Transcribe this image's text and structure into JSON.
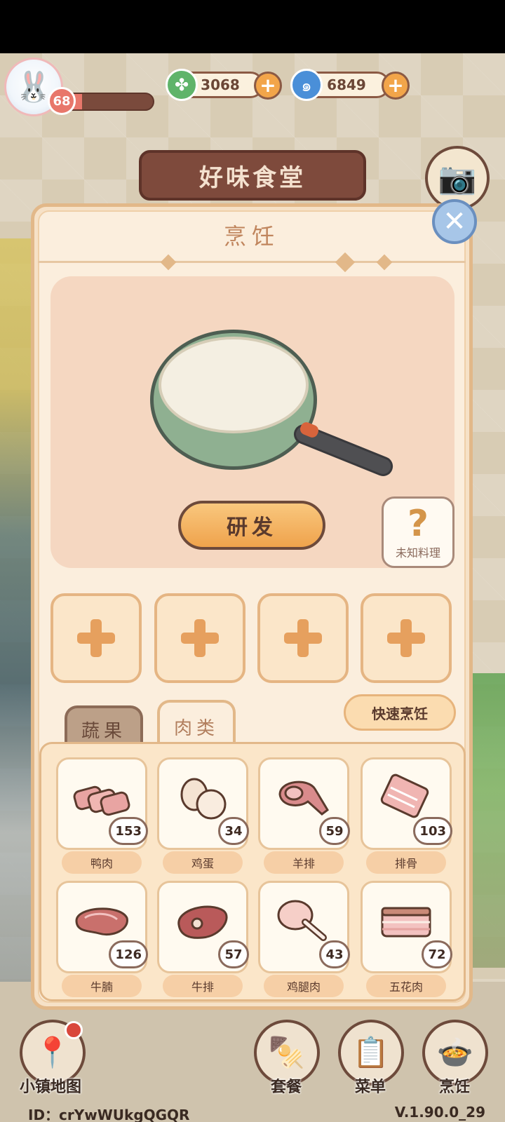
{
  "hud": {
    "level": "68",
    "level_progress": 0.3,
    "currency_green": "3068",
    "currency_blue": "6849"
  },
  "restaurant": {
    "name": "好味食堂"
  },
  "dialog": {
    "title": "烹饪",
    "develop_label": "研发",
    "unknown_label": "未知料理",
    "unknown_symbol": "?"
  },
  "tabs": [
    {
      "label": "蔬果",
      "active": false
    },
    {
      "label": "肉类",
      "active": true
    }
  ],
  "quick_cook_label": "快速烹饪",
  "ingredients": [
    {
      "name": "鸭肉",
      "count": "153",
      "icon": "duck-meat-icon"
    },
    {
      "name": "鸡蛋",
      "count": "34",
      "icon": "egg-icon"
    },
    {
      "name": "羊排",
      "count": "59",
      "icon": "lamb-chop-icon"
    },
    {
      "name": "排骨",
      "count": "103",
      "icon": "spare-ribs-icon"
    },
    {
      "name": "牛腩",
      "count": "126",
      "icon": "beef-brisket-icon"
    },
    {
      "name": "牛排",
      "count": "57",
      "icon": "steak-icon"
    },
    {
      "name": "鸡腿肉",
      "count": "43",
      "icon": "chicken-leg-icon"
    },
    {
      "name": "五花肉",
      "count": "72",
      "icon": "pork-belly-icon"
    }
  ],
  "nav": {
    "map": "小镇地图",
    "set_meal": "套餐",
    "menu": "菜单",
    "cook": "烹饪"
  },
  "footer": {
    "id_text": "ID：crYwWUkgQGQR",
    "version": "V.1.90.0_29"
  },
  "colors": {
    "panel": "#f6e1c7",
    "accent_orange": "#efa34c",
    "border_brown": "#6d4a3b"
  }
}
